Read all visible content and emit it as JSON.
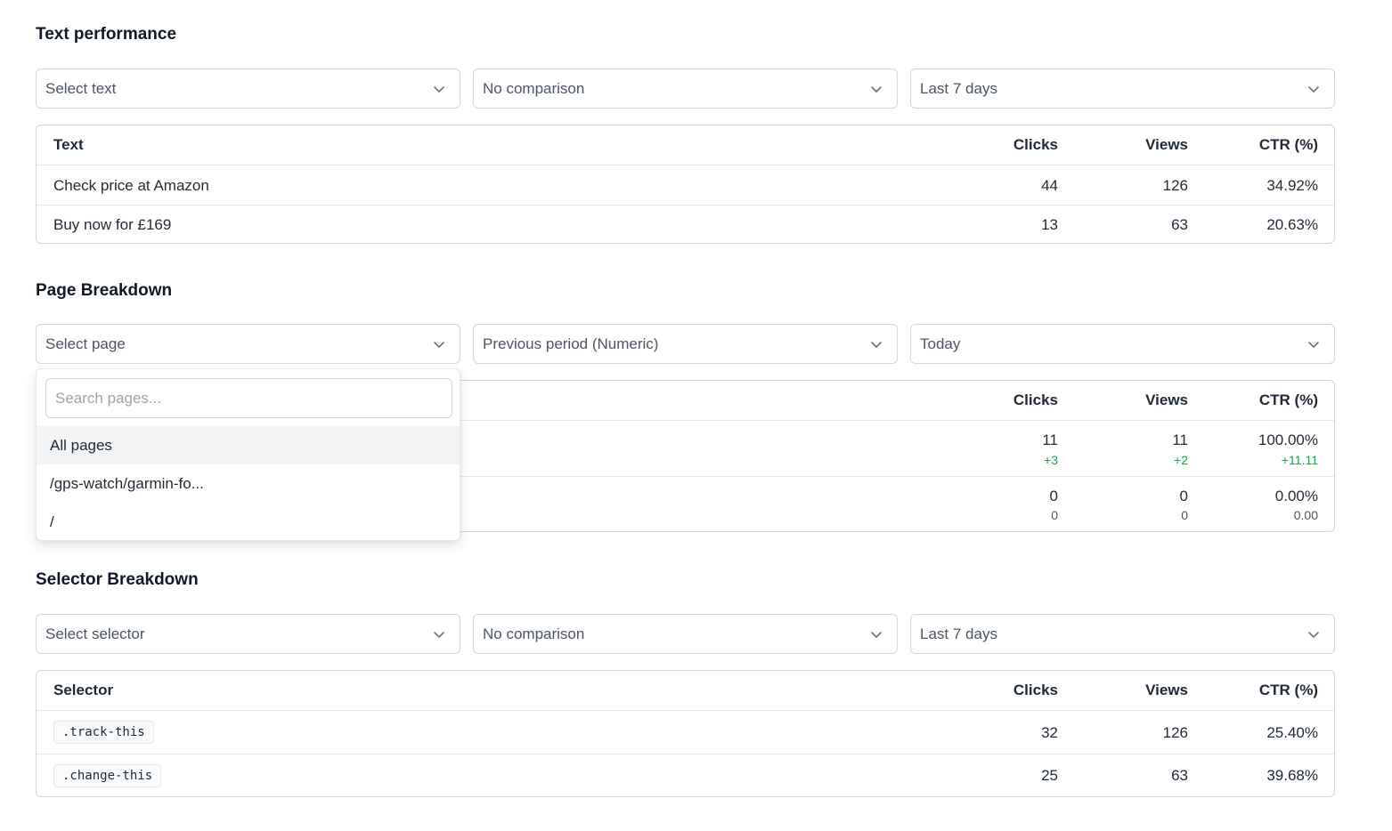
{
  "text_performance": {
    "title": "Text performance",
    "filters": {
      "text": "Select text",
      "comparison": "No comparison",
      "range": "Last 7 days"
    },
    "columns": {
      "name": "Text",
      "clicks": "Clicks",
      "views": "Views",
      "ctr": "CTR (%)"
    },
    "rows": [
      {
        "name": "Check price at Amazon",
        "clicks": "44",
        "views": "126",
        "ctr": "34.92%"
      },
      {
        "name": "Buy now for £169",
        "clicks": "13",
        "views": "63",
        "ctr": "20.63%"
      }
    ]
  },
  "page_breakdown": {
    "title": "Page Breakdown",
    "filters": {
      "page": "Select page",
      "comparison": "Previous period (Numeric)",
      "range": "Today"
    },
    "columns": {
      "clicks": "Clicks",
      "views": "Views",
      "ctr": "CTR (%)"
    },
    "rows": [
      {
        "clicks": "11",
        "clicks_delta": "+3",
        "views": "11",
        "views_delta": "+2",
        "ctr": "100.00%",
        "ctr_delta": "+11.11"
      },
      {
        "clicks": "0",
        "clicks_delta": "0",
        "views": "0",
        "views_delta": "0",
        "ctr": "0.00%",
        "ctr_delta": "0.00"
      }
    ],
    "dropdown": {
      "search_placeholder": "Search pages...",
      "options": [
        "All pages",
        "/gps-watch/garmin-fo...",
        "/"
      ]
    }
  },
  "selector_breakdown": {
    "title": "Selector Breakdown",
    "filters": {
      "selector": "Select selector",
      "comparison": "No comparison",
      "range": "Last 7 days"
    },
    "columns": {
      "name": "Selector",
      "clicks": "Clicks",
      "views": "Views",
      "ctr": "CTR (%)"
    },
    "rows": [
      {
        "name": ".track-this",
        "clicks": "32",
        "views": "126",
        "ctr": "25.40%"
      },
      {
        "name": ".change-this",
        "clicks": "25",
        "views": "63",
        "ctr": "39.68%"
      }
    ]
  },
  "colors": {
    "positive_delta": "#16a34a",
    "border": "#d1d5db",
    "active_option": "#f3f4f6"
  }
}
